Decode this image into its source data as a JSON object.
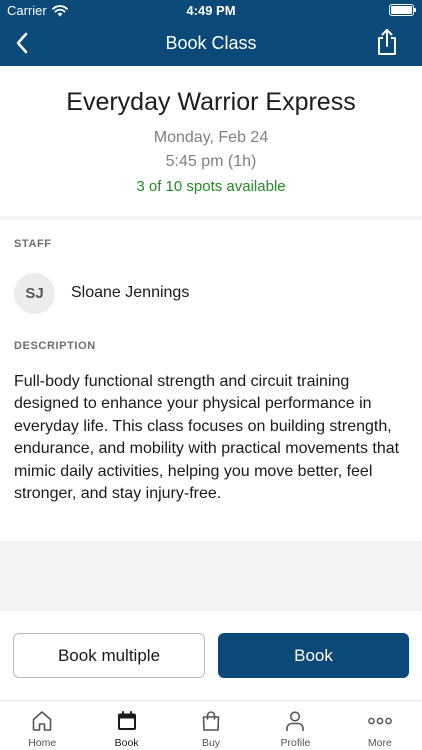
{
  "status_bar": {
    "carrier": "Carrier",
    "time": "4:49 PM"
  },
  "nav": {
    "title": "Book Class",
    "back_icon": "chevron-left-icon",
    "share_icon": "share-icon"
  },
  "class": {
    "name": "Everyday Warrior Express",
    "date": "Monday, Feb 24",
    "time": "5:45 pm (1h)",
    "spots": "3 of 10 spots available"
  },
  "staff": {
    "label": "STAFF",
    "initials": "SJ",
    "name": "Sloane Jennings"
  },
  "description": {
    "label": "DESCRIPTION",
    "text": "Full-body functional strength and circuit training designed to enhance your physical performance in everyday life. This class focuses on building strength, endurance, and mobility with practical movements that mimic daily activities, helping you move better, feel stronger, and stay injury-free."
  },
  "actions": {
    "book_multiple": "Book multiple",
    "book": "Book"
  },
  "tabs": [
    {
      "label": "Home",
      "icon": "home-icon"
    },
    {
      "label": "Book",
      "icon": "calendar-icon",
      "active": true
    },
    {
      "label": "Buy",
      "icon": "shopping-bag-icon"
    },
    {
      "label": "Profile",
      "icon": "person-icon"
    },
    {
      "label": "More",
      "icon": "more-dots-icon"
    }
  ],
  "colors": {
    "brand": "#0b4a78",
    "available": "#238d23",
    "muted": "#808080"
  }
}
